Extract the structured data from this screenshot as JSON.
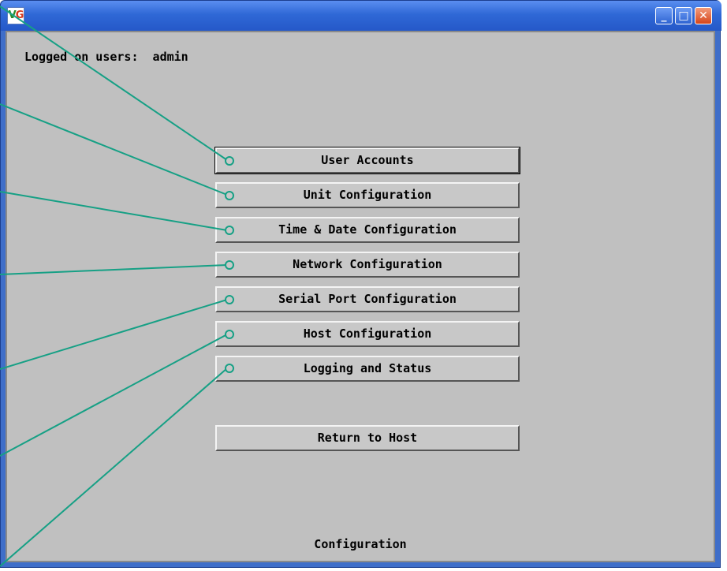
{
  "window": {
    "icon_text_v": "V",
    "icon_text_g": "G",
    "minimize_glyph": "_",
    "maximize_glyph": "□",
    "close_glyph": "✕"
  },
  "header": {
    "logged_on_users": "Logged on users:  admin"
  },
  "menu": {
    "items": [
      {
        "label": "User Accounts"
      },
      {
        "label": "Unit Configuration"
      },
      {
        "label": "Time & Date Configuration"
      },
      {
        "label": "Network Configuration"
      },
      {
        "label": "Serial Port Configuration"
      },
      {
        "label": "Host Configuration"
      },
      {
        "label": "Logging and Status"
      }
    ],
    "return_label": "Return to Host"
  },
  "status": {
    "text": "Configuration"
  },
  "colors": {
    "callout": "#16a085",
    "panel": "#c0c0c0",
    "titlebar": "#2f68d6"
  }
}
